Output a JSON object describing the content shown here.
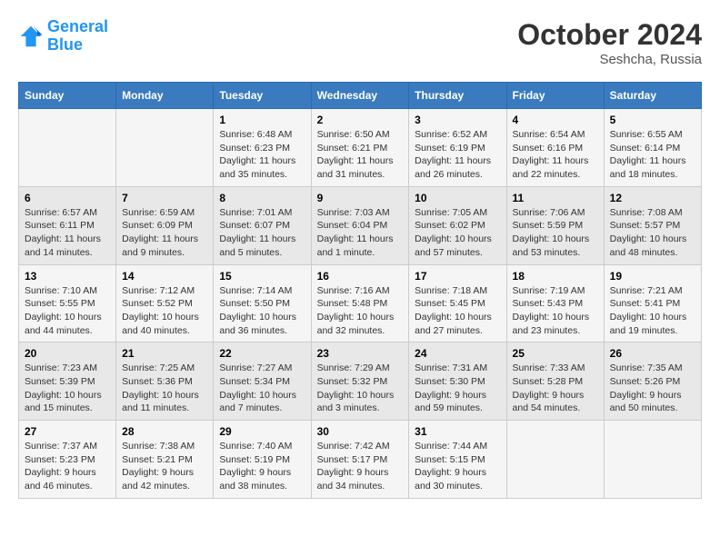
{
  "header": {
    "logo_line1": "General",
    "logo_line2": "Blue",
    "month": "October 2024",
    "location": "Seshcha, Russia"
  },
  "days_of_week": [
    "Sunday",
    "Monday",
    "Tuesday",
    "Wednesday",
    "Thursday",
    "Friday",
    "Saturday"
  ],
  "weeks": [
    [
      {
        "day": "",
        "sunrise": "",
        "sunset": "",
        "daylight": ""
      },
      {
        "day": "",
        "sunrise": "",
        "sunset": "",
        "daylight": ""
      },
      {
        "day": "1",
        "sunrise": "Sunrise: 6:48 AM",
        "sunset": "Sunset: 6:23 PM",
        "daylight": "Daylight: 11 hours and 35 minutes."
      },
      {
        "day": "2",
        "sunrise": "Sunrise: 6:50 AM",
        "sunset": "Sunset: 6:21 PM",
        "daylight": "Daylight: 11 hours and 31 minutes."
      },
      {
        "day": "3",
        "sunrise": "Sunrise: 6:52 AM",
        "sunset": "Sunset: 6:19 PM",
        "daylight": "Daylight: 11 hours and 26 minutes."
      },
      {
        "day": "4",
        "sunrise": "Sunrise: 6:54 AM",
        "sunset": "Sunset: 6:16 PM",
        "daylight": "Daylight: 11 hours and 22 minutes."
      },
      {
        "day": "5",
        "sunrise": "Sunrise: 6:55 AM",
        "sunset": "Sunset: 6:14 PM",
        "daylight": "Daylight: 11 hours and 18 minutes."
      }
    ],
    [
      {
        "day": "6",
        "sunrise": "Sunrise: 6:57 AM",
        "sunset": "Sunset: 6:11 PM",
        "daylight": "Daylight: 11 hours and 14 minutes."
      },
      {
        "day": "7",
        "sunrise": "Sunrise: 6:59 AM",
        "sunset": "Sunset: 6:09 PM",
        "daylight": "Daylight: 11 hours and 9 minutes."
      },
      {
        "day": "8",
        "sunrise": "Sunrise: 7:01 AM",
        "sunset": "Sunset: 6:07 PM",
        "daylight": "Daylight: 11 hours and 5 minutes."
      },
      {
        "day": "9",
        "sunrise": "Sunrise: 7:03 AM",
        "sunset": "Sunset: 6:04 PM",
        "daylight": "Daylight: 11 hours and 1 minute."
      },
      {
        "day": "10",
        "sunrise": "Sunrise: 7:05 AM",
        "sunset": "Sunset: 6:02 PM",
        "daylight": "Daylight: 10 hours and 57 minutes."
      },
      {
        "day": "11",
        "sunrise": "Sunrise: 7:06 AM",
        "sunset": "Sunset: 5:59 PM",
        "daylight": "Daylight: 10 hours and 53 minutes."
      },
      {
        "day": "12",
        "sunrise": "Sunrise: 7:08 AM",
        "sunset": "Sunset: 5:57 PM",
        "daylight": "Daylight: 10 hours and 48 minutes."
      }
    ],
    [
      {
        "day": "13",
        "sunrise": "Sunrise: 7:10 AM",
        "sunset": "Sunset: 5:55 PM",
        "daylight": "Daylight: 10 hours and 44 minutes."
      },
      {
        "day": "14",
        "sunrise": "Sunrise: 7:12 AM",
        "sunset": "Sunset: 5:52 PM",
        "daylight": "Daylight: 10 hours and 40 minutes."
      },
      {
        "day": "15",
        "sunrise": "Sunrise: 7:14 AM",
        "sunset": "Sunset: 5:50 PM",
        "daylight": "Daylight: 10 hours and 36 minutes."
      },
      {
        "day": "16",
        "sunrise": "Sunrise: 7:16 AM",
        "sunset": "Sunset: 5:48 PM",
        "daylight": "Daylight: 10 hours and 32 minutes."
      },
      {
        "day": "17",
        "sunrise": "Sunrise: 7:18 AM",
        "sunset": "Sunset: 5:45 PM",
        "daylight": "Daylight: 10 hours and 27 minutes."
      },
      {
        "day": "18",
        "sunrise": "Sunrise: 7:19 AM",
        "sunset": "Sunset: 5:43 PM",
        "daylight": "Daylight: 10 hours and 23 minutes."
      },
      {
        "day": "19",
        "sunrise": "Sunrise: 7:21 AM",
        "sunset": "Sunset: 5:41 PM",
        "daylight": "Daylight: 10 hours and 19 minutes."
      }
    ],
    [
      {
        "day": "20",
        "sunrise": "Sunrise: 7:23 AM",
        "sunset": "Sunset: 5:39 PM",
        "daylight": "Daylight: 10 hours and 15 minutes."
      },
      {
        "day": "21",
        "sunrise": "Sunrise: 7:25 AM",
        "sunset": "Sunset: 5:36 PM",
        "daylight": "Daylight: 10 hours and 11 minutes."
      },
      {
        "day": "22",
        "sunrise": "Sunrise: 7:27 AM",
        "sunset": "Sunset: 5:34 PM",
        "daylight": "Daylight: 10 hours and 7 minutes."
      },
      {
        "day": "23",
        "sunrise": "Sunrise: 7:29 AM",
        "sunset": "Sunset: 5:32 PM",
        "daylight": "Daylight: 10 hours and 3 minutes."
      },
      {
        "day": "24",
        "sunrise": "Sunrise: 7:31 AM",
        "sunset": "Sunset: 5:30 PM",
        "daylight": "Daylight: 9 hours and 59 minutes."
      },
      {
        "day": "25",
        "sunrise": "Sunrise: 7:33 AM",
        "sunset": "Sunset: 5:28 PM",
        "daylight": "Daylight: 9 hours and 54 minutes."
      },
      {
        "day": "26",
        "sunrise": "Sunrise: 7:35 AM",
        "sunset": "Sunset: 5:26 PM",
        "daylight": "Daylight: 9 hours and 50 minutes."
      }
    ],
    [
      {
        "day": "27",
        "sunrise": "Sunrise: 7:37 AM",
        "sunset": "Sunset: 5:23 PM",
        "daylight": "Daylight: 9 hours and 46 minutes."
      },
      {
        "day": "28",
        "sunrise": "Sunrise: 7:38 AM",
        "sunset": "Sunset: 5:21 PM",
        "daylight": "Daylight: 9 hours and 42 minutes."
      },
      {
        "day": "29",
        "sunrise": "Sunrise: 7:40 AM",
        "sunset": "Sunset: 5:19 PM",
        "daylight": "Daylight: 9 hours and 38 minutes."
      },
      {
        "day": "30",
        "sunrise": "Sunrise: 7:42 AM",
        "sunset": "Sunset: 5:17 PM",
        "daylight": "Daylight: 9 hours and 34 minutes."
      },
      {
        "day": "31",
        "sunrise": "Sunrise: 7:44 AM",
        "sunset": "Sunset: 5:15 PM",
        "daylight": "Daylight: 9 hours and 30 minutes."
      },
      {
        "day": "",
        "sunrise": "",
        "sunset": "",
        "daylight": ""
      },
      {
        "day": "",
        "sunrise": "",
        "sunset": "",
        "daylight": ""
      }
    ]
  ]
}
